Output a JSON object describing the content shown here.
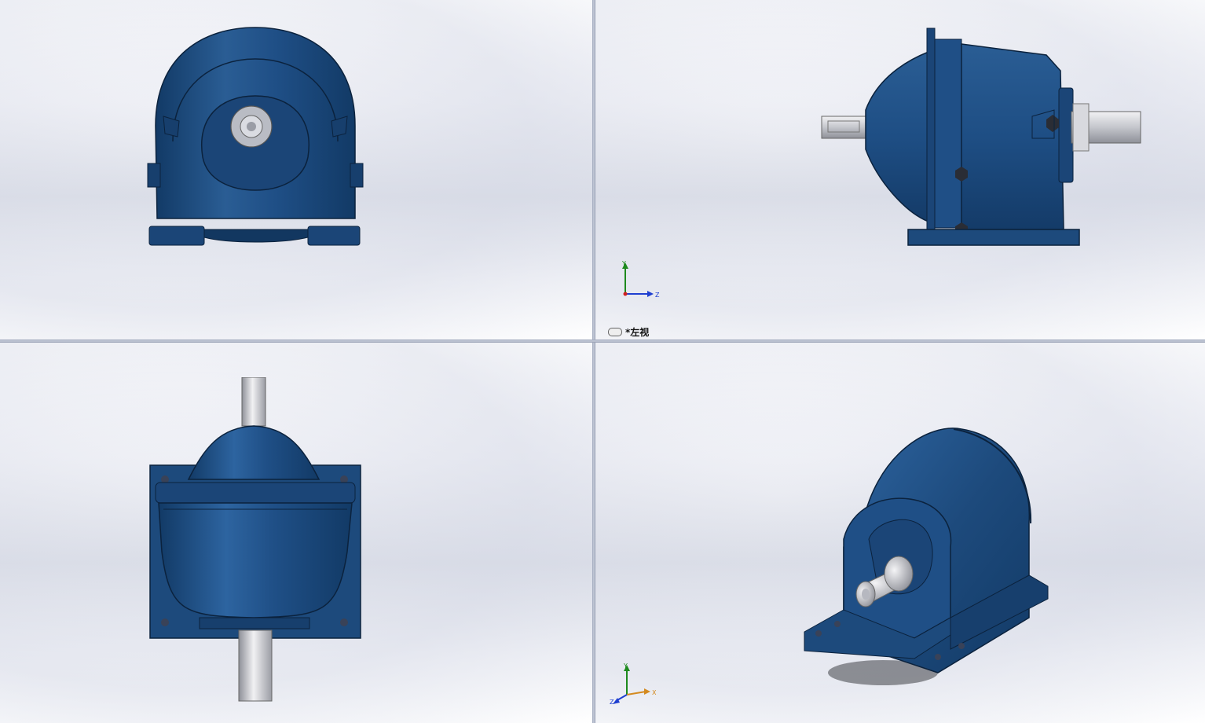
{
  "viewports": {
    "top_left": {
      "view": "front"
    },
    "top_right": {
      "view": "left",
      "label": "*左视"
    },
    "bottom_left": {
      "view": "top"
    },
    "bottom_right": {
      "view": "isometric"
    }
  },
  "triad": {
    "y": "Y",
    "z": "Z",
    "x": "X"
  },
  "colors": {
    "housing": "#1d4a7c",
    "shaft": "#c8c8cc",
    "axis_x": "#d02020",
    "axis_y": "#1d8a1d",
    "axis_z": "#1f3fd0"
  }
}
